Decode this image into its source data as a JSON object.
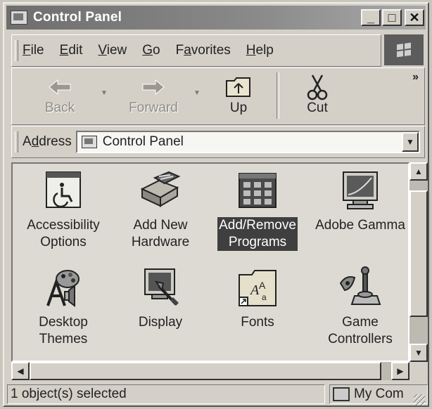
{
  "window": {
    "title": "Control Panel",
    "buttons": {
      "minimize": "_",
      "maximize": "□",
      "close": "✕"
    }
  },
  "menu": {
    "items": [
      {
        "u": "F",
        "rest": "ile"
      },
      {
        "u": "E",
        "rest": "dit"
      },
      {
        "u": "V",
        "rest": "iew"
      },
      {
        "u": "G",
        "rest": "o"
      },
      {
        "pre": "F",
        "u": "a",
        "rest": "vorites"
      },
      {
        "u": "H",
        "rest": "elp"
      }
    ]
  },
  "toolbar": {
    "back": "Back",
    "forward": "Forward",
    "up": "Up",
    "cut": "Cut",
    "more": "»"
  },
  "address": {
    "label_pre": "A",
    "label_u": "d",
    "label_rest": "dress",
    "value": "Control Panel"
  },
  "items": [
    {
      "line1": "Accessibility",
      "line2": "Options"
    },
    {
      "line1": "Add New",
      "line2": "Hardware"
    },
    {
      "line1": "Add/Remove",
      "line2": "Programs",
      "selected": true
    },
    {
      "line1": "Adobe Gamma",
      "line2": ""
    },
    {
      "line1": "Desktop",
      "line2": "Themes"
    },
    {
      "line1": "Display",
      "line2": ""
    },
    {
      "line1": "Fonts",
      "line2": ""
    },
    {
      "line1": "Game",
      "line2": "Controllers"
    }
  ],
  "status": {
    "selection": "1 object(s) selected",
    "zone": "My Com"
  }
}
